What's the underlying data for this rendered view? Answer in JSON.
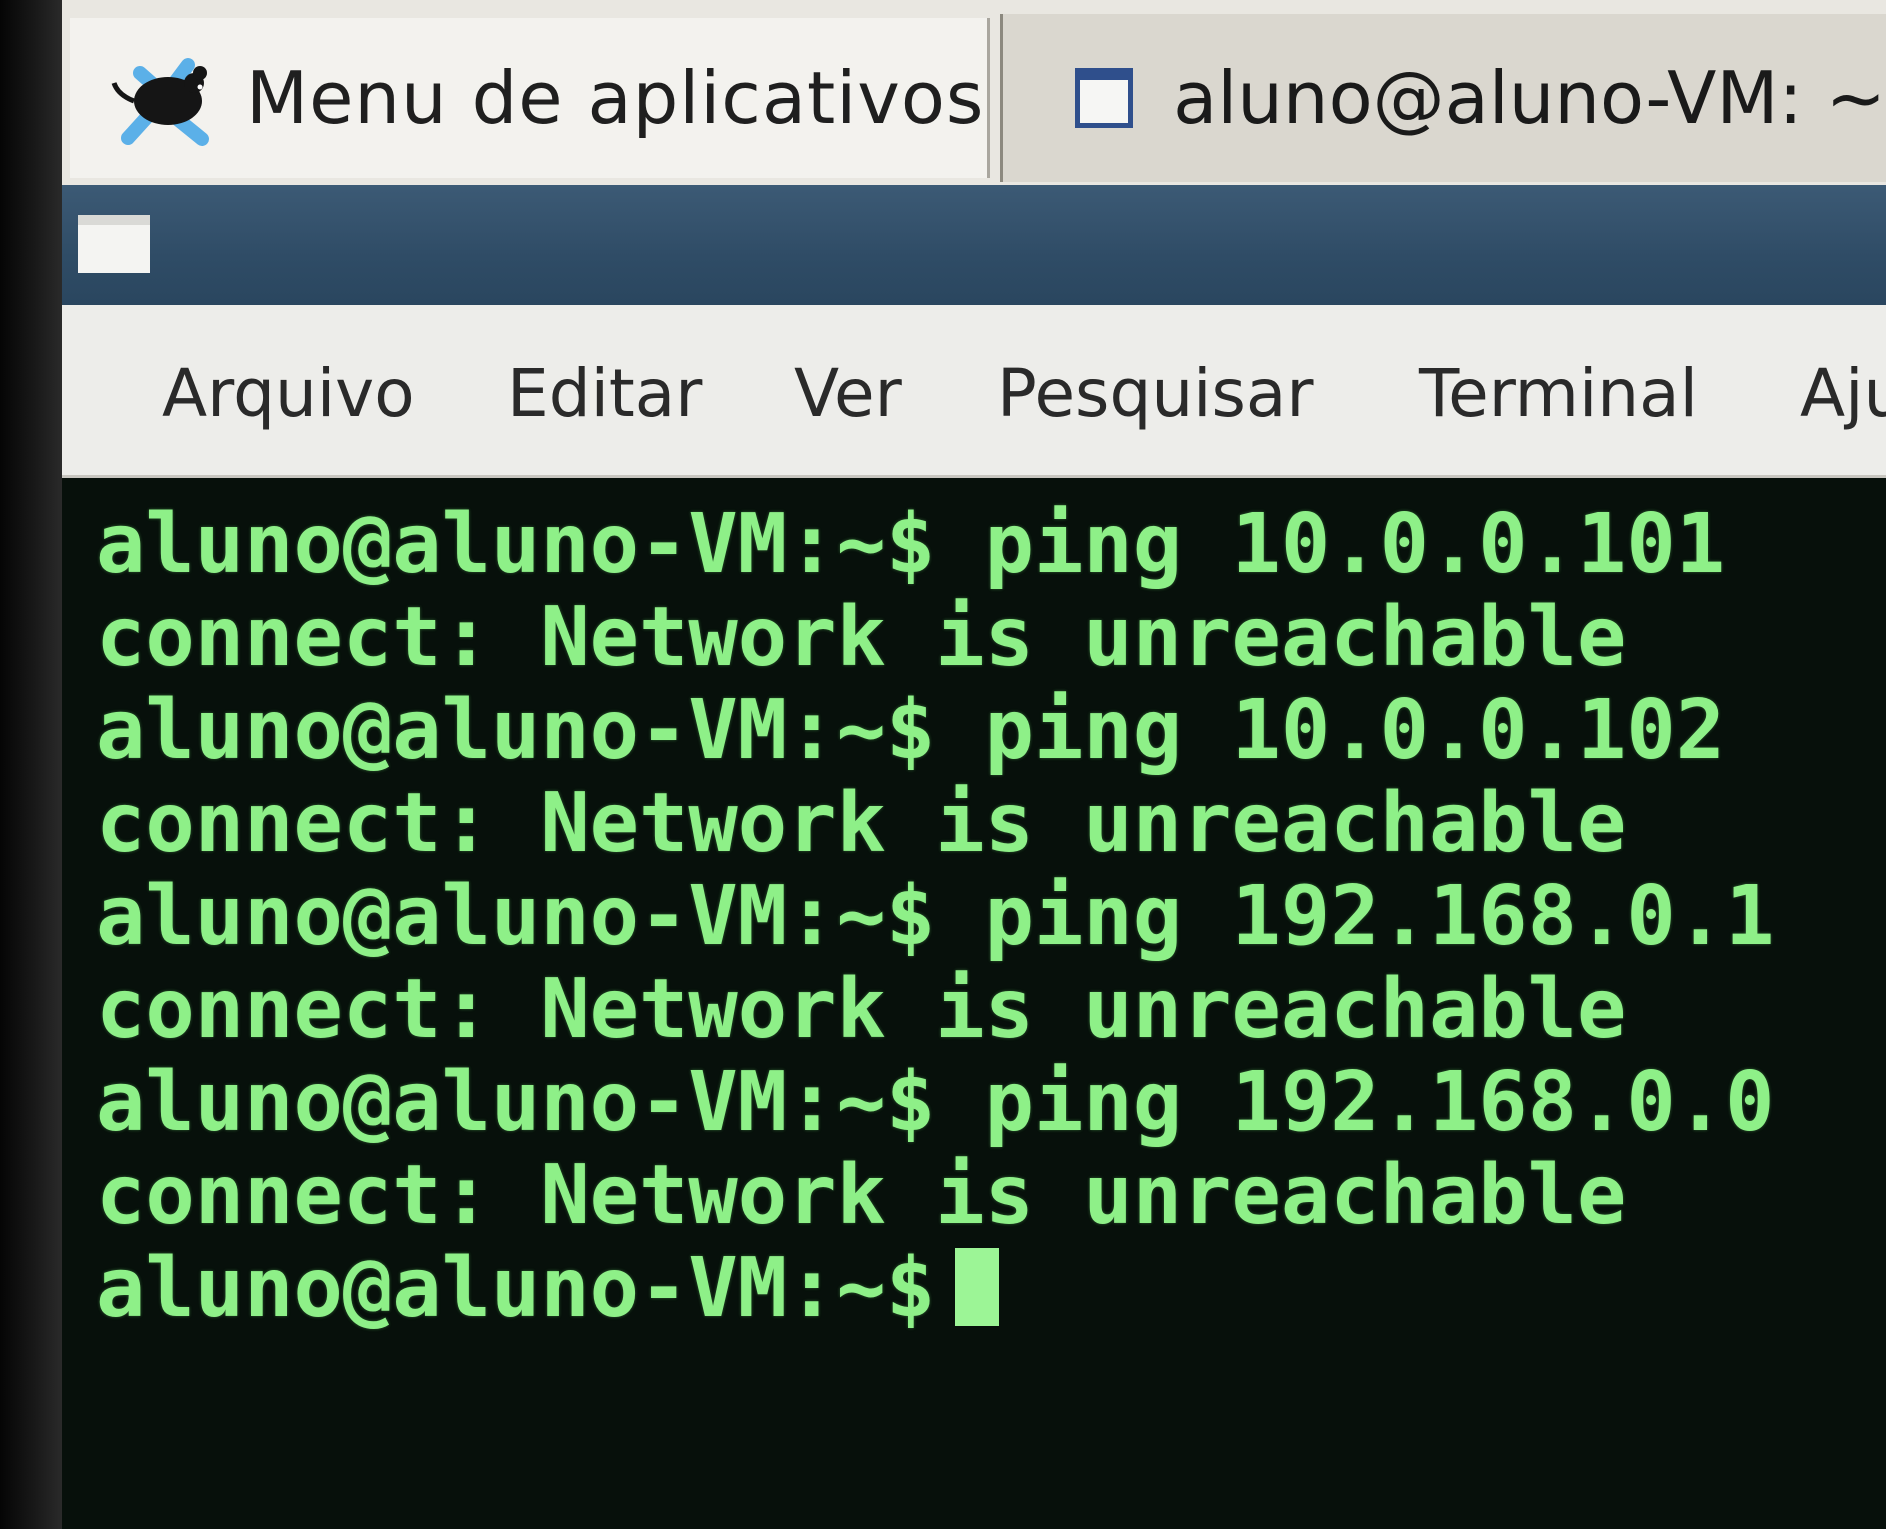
{
  "panel": {
    "app_menu_label": "Menu de aplicativos",
    "app_menu_icon": "mouse-icon",
    "task_label": "aluno@aluno-VM: ~",
    "task_icon": "window-icon"
  },
  "menubar": {
    "items": [
      "Arquivo",
      "Editar",
      "Ver",
      "Pesquisar",
      "Terminal",
      "Aju"
    ]
  },
  "terminal": {
    "lines": [
      "aluno@aluno-VM:~$ ping 10.0.0.101",
      "connect: Network is unreachable",
      "aluno@aluno-VM:~$ ping 10.0.0.102",
      "connect: Network is unreachable",
      "aluno@aluno-VM:~$ ping 192.168.0.1",
      "connect: Network is unreachable",
      "aluno@aluno-VM:~$ ping 192.168.0.0",
      "connect: Network is unreachable"
    ],
    "prompt": "aluno@aluno-VM:~$",
    "text_color": "#8ef088",
    "background_color": "#07100b"
  }
}
